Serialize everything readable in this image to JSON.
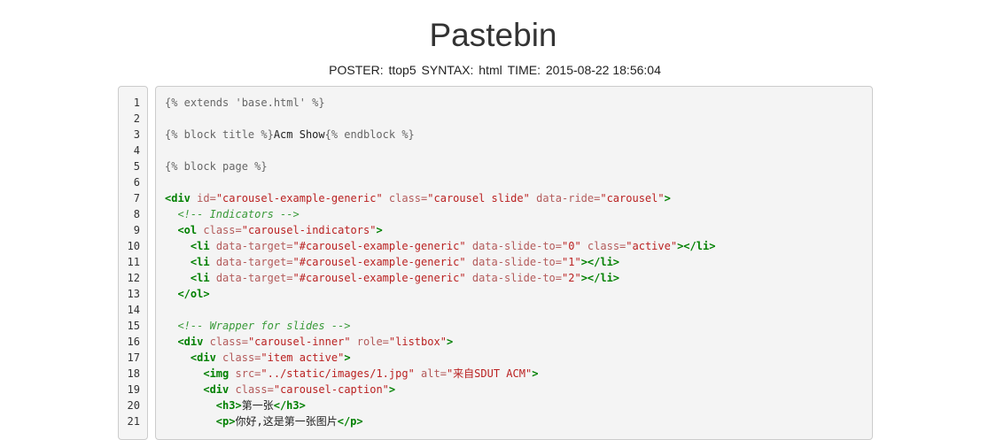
{
  "title": "Pastebin",
  "meta": {
    "poster_label": "POSTER:",
    "poster_value": "ttop5",
    "syntax_label": "SYNTAX:",
    "syntax_value": "html",
    "time_label": "TIME:",
    "time_value": "2015-08-22 18:56:04"
  },
  "line_numbers": [
    "1",
    "2",
    "3",
    "4",
    "5",
    "6",
    "7",
    "8",
    "9",
    "10",
    "11",
    "12",
    "13",
    "14",
    "15",
    "16",
    "17",
    "18",
    "19",
    "20",
    "21"
  ],
  "code_lines": [
    [
      {
        "t": "tpl",
        "v": "{% extends 'base.html' %}"
      }
    ],
    [],
    [
      {
        "t": "tpl",
        "v": "{% block title %}"
      },
      {
        "t": "txt",
        "v": "Acm Show"
      },
      {
        "t": "tpl",
        "v": "{% endblock %}"
      }
    ],
    [],
    [
      {
        "t": "tpl",
        "v": "{% block page %}"
      }
    ],
    [],
    [
      {
        "t": "tag",
        "v": "<div"
      },
      {
        "t": "txt",
        "v": " "
      },
      {
        "t": "aname",
        "v": "id="
      },
      {
        "t": "str",
        "v": "\"carousel-example-generic\""
      },
      {
        "t": "txt",
        "v": " "
      },
      {
        "t": "aname",
        "v": "class="
      },
      {
        "t": "str",
        "v": "\"carousel slide\""
      },
      {
        "t": "txt",
        "v": " "
      },
      {
        "t": "aname",
        "v": "data-ride="
      },
      {
        "t": "str",
        "v": "\"carousel\""
      },
      {
        "t": "tag",
        "v": ">"
      }
    ],
    [
      {
        "t": "txt",
        "v": "  "
      },
      {
        "t": "cmt",
        "v": "<!-- Indicators -->"
      }
    ],
    [
      {
        "t": "txt",
        "v": "  "
      },
      {
        "t": "tag",
        "v": "<ol"
      },
      {
        "t": "txt",
        "v": " "
      },
      {
        "t": "aname",
        "v": "class="
      },
      {
        "t": "str",
        "v": "\"carousel-indicators\""
      },
      {
        "t": "tag",
        "v": ">"
      }
    ],
    [
      {
        "t": "txt",
        "v": "    "
      },
      {
        "t": "tag",
        "v": "<li"
      },
      {
        "t": "txt",
        "v": " "
      },
      {
        "t": "aname",
        "v": "data-target="
      },
      {
        "t": "str",
        "v": "\"#carousel-example-generic\""
      },
      {
        "t": "txt",
        "v": " "
      },
      {
        "t": "aname",
        "v": "data-slide-to="
      },
      {
        "t": "str",
        "v": "\"0\""
      },
      {
        "t": "txt",
        "v": " "
      },
      {
        "t": "aname",
        "v": "class="
      },
      {
        "t": "str",
        "v": "\"active\""
      },
      {
        "t": "tag",
        "v": "></li>"
      }
    ],
    [
      {
        "t": "txt",
        "v": "    "
      },
      {
        "t": "tag",
        "v": "<li"
      },
      {
        "t": "txt",
        "v": " "
      },
      {
        "t": "aname",
        "v": "data-target="
      },
      {
        "t": "str",
        "v": "\"#carousel-example-generic\""
      },
      {
        "t": "txt",
        "v": " "
      },
      {
        "t": "aname",
        "v": "data-slide-to="
      },
      {
        "t": "str",
        "v": "\"1\""
      },
      {
        "t": "tag",
        "v": "></li>"
      }
    ],
    [
      {
        "t": "txt",
        "v": "    "
      },
      {
        "t": "tag",
        "v": "<li"
      },
      {
        "t": "txt",
        "v": " "
      },
      {
        "t": "aname",
        "v": "data-target="
      },
      {
        "t": "str",
        "v": "\"#carousel-example-generic\""
      },
      {
        "t": "txt",
        "v": " "
      },
      {
        "t": "aname",
        "v": "data-slide-to="
      },
      {
        "t": "str",
        "v": "\"2\""
      },
      {
        "t": "tag",
        "v": "></li>"
      }
    ],
    [
      {
        "t": "txt",
        "v": "  "
      },
      {
        "t": "tag",
        "v": "</ol>"
      }
    ],
    [],
    [
      {
        "t": "txt",
        "v": "  "
      },
      {
        "t": "cmt",
        "v": "<!-- Wrapper for slides -->"
      }
    ],
    [
      {
        "t": "txt",
        "v": "  "
      },
      {
        "t": "tag",
        "v": "<div"
      },
      {
        "t": "txt",
        "v": " "
      },
      {
        "t": "aname",
        "v": "class="
      },
      {
        "t": "str",
        "v": "\"carousel-inner\""
      },
      {
        "t": "txt",
        "v": " "
      },
      {
        "t": "aname",
        "v": "role="
      },
      {
        "t": "str",
        "v": "\"listbox\""
      },
      {
        "t": "tag",
        "v": ">"
      }
    ],
    [
      {
        "t": "txt",
        "v": "    "
      },
      {
        "t": "tag",
        "v": "<div"
      },
      {
        "t": "txt",
        "v": " "
      },
      {
        "t": "aname",
        "v": "class="
      },
      {
        "t": "str",
        "v": "\"item active\""
      },
      {
        "t": "tag",
        "v": ">"
      }
    ],
    [
      {
        "t": "txt",
        "v": "      "
      },
      {
        "t": "tag",
        "v": "<img"
      },
      {
        "t": "txt",
        "v": " "
      },
      {
        "t": "aname",
        "v": "src="
      },
      {
        "t": "str",
        "v": "\"../static/images/1.jpg\""
      },
      {
        "t": "txt",
        "v": " "
      },
      {
        "t": "aname",
        "v": "alt="
      },
      {
        "t": "str",
        "v": "\"来自SDUT ACM\""
      },
      {
        "t": "tag",
        "v": ">"
      }
    ],
    [
      {
        "t": "txt",
        "v": "      "
      },
      {
        "t": "tag",
        "v": "<div"
      },
      {
        "t": "txt",
        "v": " "
      },
      {
        "t": "aname",
        "v": "class="
      },
      {
        "t": "str",
        "v": "\"carousel-caption\""
      },
      {
        "t": "tag",
        "v": ">"
      }
    ],
    [
      {
        "t": "txt",
        "v": "        "
      },
      {
        "t": "tag",
        "v": "<h3>"
      },
      {
        "t": "txt",
        "v": "第一张"
      },
      {
        "t": "tag",
        "v": "</h3>"
      }
    ],
    [
      {
        "t": "txt",
        "v": "        "
      },
      {
        "t": "tag",
        "v": "<p>"
      },
      {
        "t": "txt",
        "v": "你好,这是第一张图片"
      },
      {
        "t": "tag",
        "v": "</p>"
      }
    ]
  ]
}
